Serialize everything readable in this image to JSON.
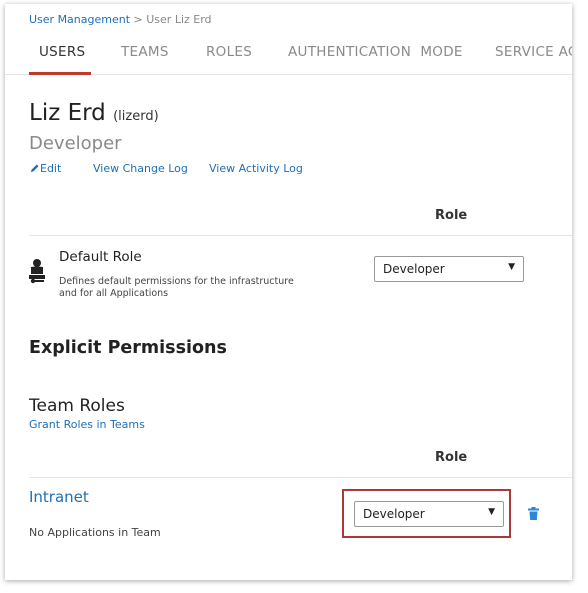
{
  "breadcrumb": {
    "parent": "User Management",
    "separator": " > ",
    "current": "User Liz Erd"
  },
  "tabs": [
    {
      "label": "USERS",
      "active": true
    },
    {
      "label": "TEAMS"
    },
    {
      "label": "ROLES"
    },
    {
      "label": "AUTHENTICATION  MODE"
    },
    {
      "label": "SERVICE ACCO"
    }
  ],
  "user": {
    "name": "Liz Erd",
    "login": "(lizerd)",
    "role": "Developer"
  },
  "actions": {
    "edit": "Edit",
    "change_log": "View Change Log",
    "activity_log": "View Activity Log"
  },
  "default_role": {
    "column_header": "Role",
    "title": "Default Role",
    "description": "Defines default permissions for the infrastructure and for all Applications",
    "selected": "Developer"
  },
  "explicit": {
    "title": "Explicit Permissions"
  },
  "team_roles": {
    "title": "Team Roles",
    "grant_link": "Grant Roles in Teams",
    "column_header": "Role",
    "teams": [
      {
        "name": "Intranet",
        "meta": "No Applications in Team",
        "selected": "Developer"
      }
    ]
  },
  "icons": {
    "user": "user-role-icon",
    "edit": "pencil-icon",
    "delete": "trash-icon",
    "caret": "caret-down-icon"
  },
  "colors": {
    "link": "#1f6fb8",
    "active_tab": "#c0392b",
    "highlight": "#a83a3a"
  }
}
